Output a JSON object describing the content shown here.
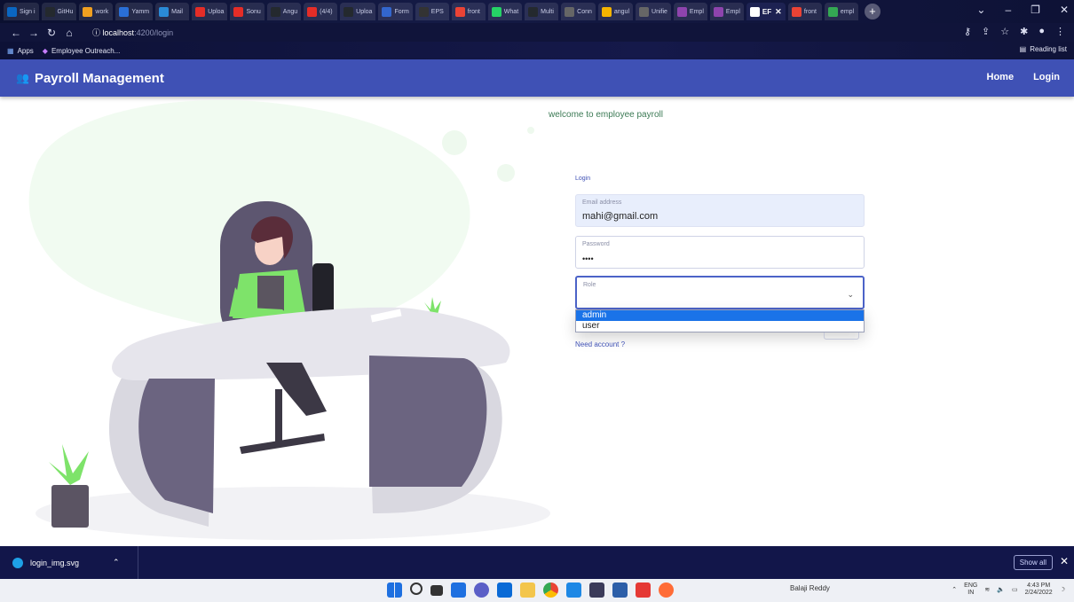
{
  "browser": {
    "tabs": [
      {
        "label": "Sign i",
        "color": "#0a66c2"
      },
      {
        "label": "GitHu",
        "color": "#24292e"
      },
      {
        "label": "work",
        "color": "#f0a020"
      },
      {
        "label": "Yamm",
        "color": "#2a6fd6"
      },
      {
        "label": "Mail",
        "color": "#2a8ad6"
      },
      {
        "label": "Uploa",
        "color": "#e52d27"
      },
      {
        "label": "Sonu",
        "color": "#e52d27"
      },
      {
        "label": "Angu",
        "color": "#24292e"
      },
      {
        "label": "(4/4)",
        "color": "#e52d27"
      },
      {
        "label": "Uploa",
        "color": "#24292e"
      },
      {
        "label": "Form",
        "color": "#3366cc"
      },
      {
        "label": "EPS",
        "color": "#333333"
      },
      {
        "label": "front",
        "color": "#ea4335"
      },
      {
        "label": "What",
        "color": "#25d366"
      },
      {
        "label": "Multi",
        "color": "#24292e"
      },
      {
        "label": "Conn",
        "color": "#666666"
      },
      {
        "label": "angul",
        "color": "#f4b400"
      },
      {
        "label": "Unifie",
        "color": "#666666"
      },
      {
        "label": "Empl",
        "color": "#8e44ad"
      },
      {
        "label": "Empl",
        "color": "#8e44ad"
      },
      {
        "label": "EF",
        "color": "#ffffff",
        "active": true
      },
      {
        "label": "front",
        "color": "#ea4335"
      },
      {
        "label": "empl",
        "color": "#34a853"
      }
    ],
    "url_host": "localhost",
    "url_path": ":4200/login",
    "bookmarks": [
      {
        "label": "Apps"
      },
      {
        "label": "Employee Outreach..."
      }
    ],
    "reading_list": "Reading list"
  },
  "app": {
    "title": "Payroll Management",
    "nav": [
      {
        "label": "Home"
      },
      {
        "label": "Login"
      }
    ]
  },
  "login": {
    "welcome": "welcome to employee payroll",
    "form_label": "Login",
    "email": {
      "label": "Email address",
      "value": "mahi@gmail.com"
    },
    "password": {
      "label": "Password",
      "value": "••••"
    },
    "role": {
      "label": "Role",
      "options": [
        "admin",
        "user"
      ],
      "highlighted": "admin"
    },
    "need_account": "Need account ?"
  },
  "downloads": {
    "file": "login_img.svg",
    "show_all": "Show all"
  },
  "taskbar": {
    "user": "Balaji Reddy",
    "lang_top": "ENG",
    "lang_bottom": "IN",
    "time": "4:43 PM",
    "date": "2/24/2022"
  }
}
